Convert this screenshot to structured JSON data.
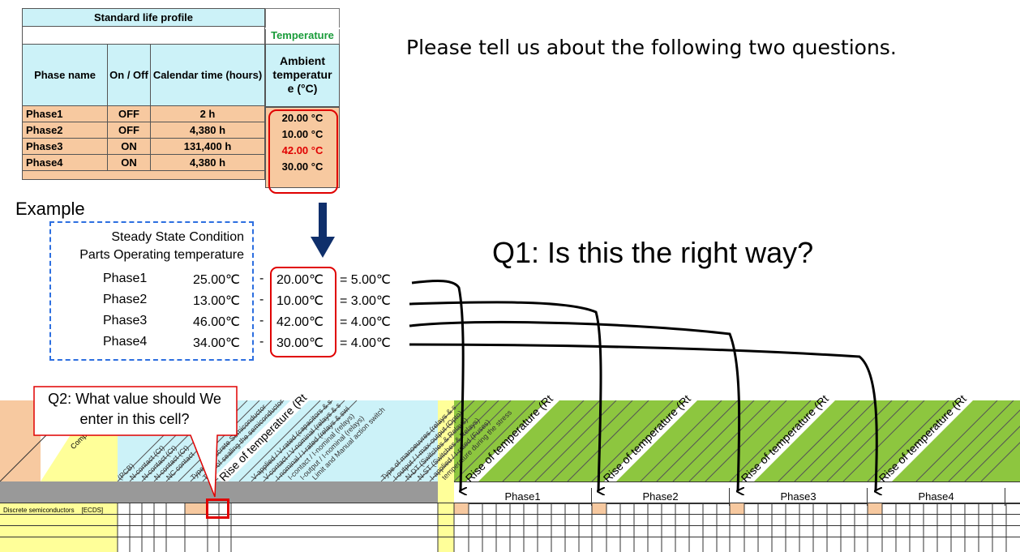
{
  "life_profile": {
    "title": "Standard life profile",
    "headers": {
      "phase": "Phase name",
      "onoff": "On / Off",
      "calendar": "Calendar time (hours)"
    },
    "rows": [
      {
        "phase": "Phase1",
        "onoff": "OFF",
        "time": "2 h"
      },
      {
        "phase": "Phase2",
        "onoff": "OFF",
        "time": "4,380 h"
      },
      {
        "phase": "Phase3",
        "onoff": "ON",
        "time": "131,400 h"
      },
      {
        "phase": "Phase4",
        "onoff": "ON",
        "time": "4,380 h"
      }
    ]
  },
  "temperature": {
    "group_label": "Temperature",
    "header_lines": [
      "Ambient",
      "temperatur",
      "e (°C)"
    ],
    "values": [
      "20.00 °C",
      "10.00 °C",
      "42.00 °C",
      "30.00 °C"
    ]
  },
  "intro": "Please tell us about the following two questions.",
  "example": {
    "label": "Example",
    "box_line1": "Steady State Condition",
    "box_line2": "Parts Operating temperature",
    "rows": [
      {
        "phase": "Phase1",
        "op": "25.00℃",
        "amb": "20.00℃",
        "res": "= 5.00℃"
      },
      {
        "phase": "Phase2",
        "op": "13.00℃",
        "amb": "10.00℃",
        "res": "= 3.00℃"
      },
      {
        "phase": "Phase3",
        "op": "46.00℃",
        "amb": "42.00℃",
        "res": "= 4.00℃"
      },
      {
        "phase": "Phase4",
        "op": "34.00℃",
        "amb": "30.00℃",
        "res": "= 4.00℃"
      }
    ],
    "minus": "-"
  },
  "q1": "Q1: Is this the right way?",
  "q2_line1": "Q2: What value should We",
  "q2_line2": "enter in this cell?",
  "sheet": {
    "component_type": "Component type",
    "row_label": "Discrete semiconductors",
    "row_code": "[ECDS]",
    "rise_label": "Rise of temperature (Rt",
    "phases": [
      "Phase1",
      "Phase2",
      "Phase3",
      "Phase4"
    ],
    "small_headers": [
      "(PCB)",
      "N-contact (Ct)",
      "N-contact (Ct)",
      "N-contact (Ct)",
      "NC contact",
      "Type of Discrete Semiconductor",
      "Type of sealing the semiconductor",
      "V-applied / V-rated (capacitors & s",
      "V-contact / V-nominal (relays & s",
      "I-nominal / I-rated (relays & swi",
      "I-contact / I-nominal (relays)",
      "I-output / I-nominal (relays)",
      "Limit and Manual action switch",
      "Type of manoeuvres (relays & s",
      "I-output / I-max-output (Opto)",
      "N-DT (Switches & Relays)",
      "N-ST (Switches & Relays)",
      "I-applied / I-rated (Fuses)",
      "temperature during the stress"
    ],
    "colors": {
      "cyan": "#ccf2f8",
      "green": "#8dc63f",
      "yellow": "#ffff99",
      "orange": "#f7c9a0",
      "gray": "#999999"
    }
  }
}
